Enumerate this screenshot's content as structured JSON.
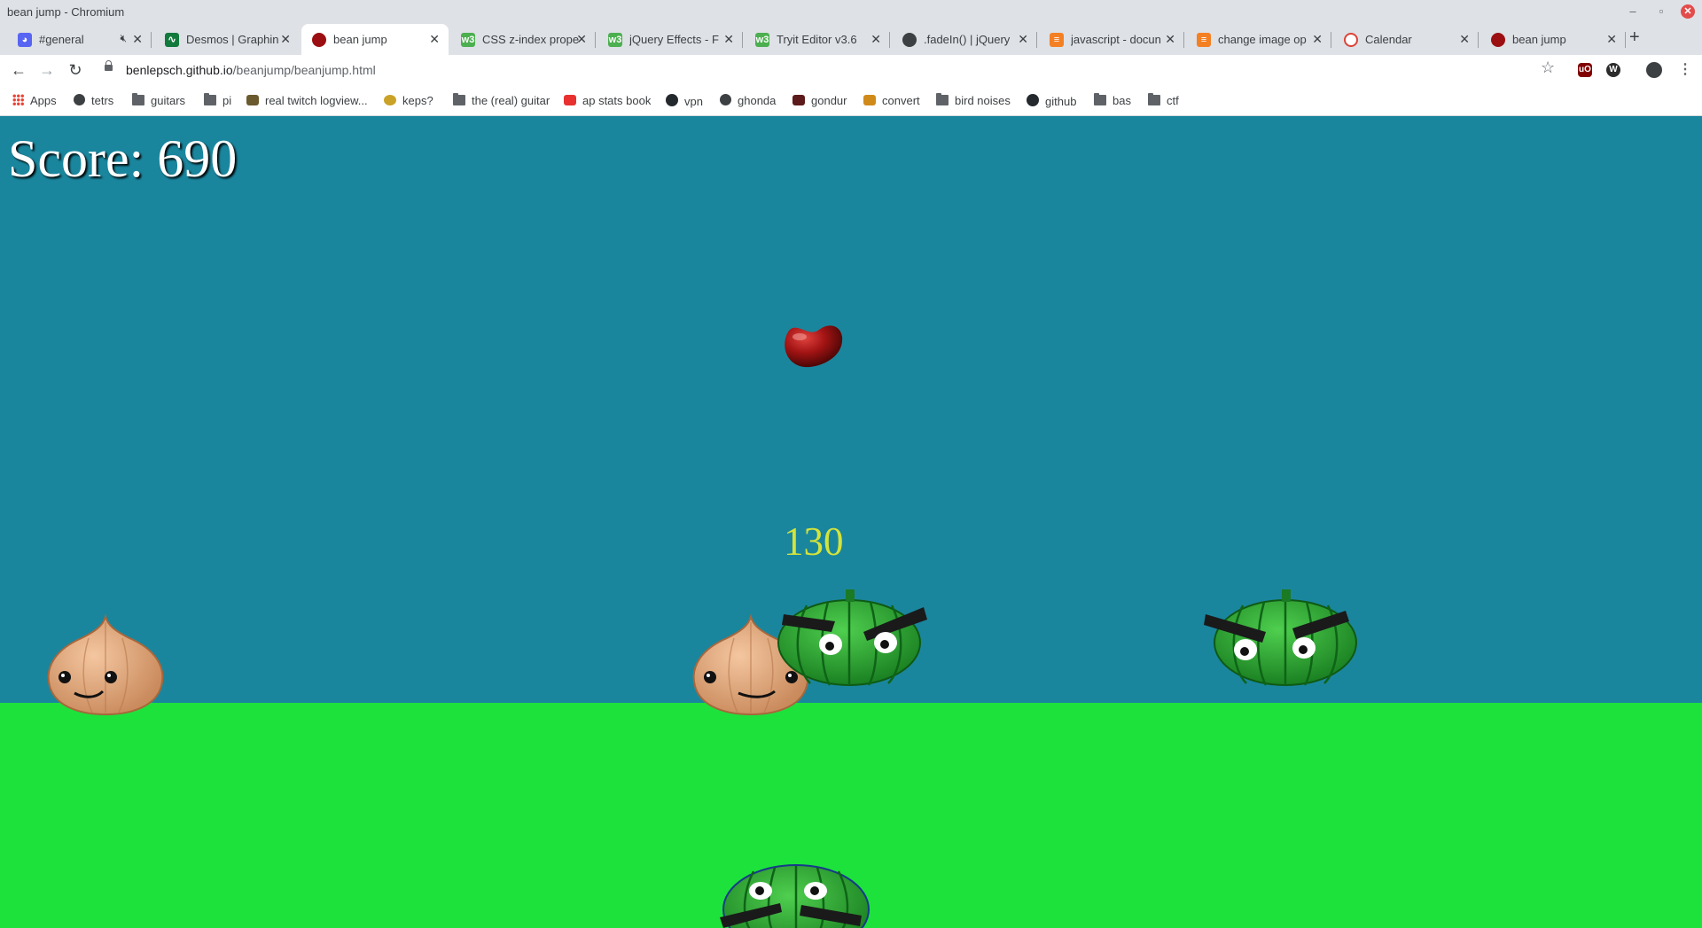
{
  "window": {
    "title": "bean jump - Chromium"
  },
  "tabs": [
    {
      "label": "#general",
      "icon": "discord-icon",
      "color": "#5865f2"
    },
    {
      "label": "Desmos | Graphin",
      "icon": "desmos-icon",
      "color": "#127a3d"
    },
    {
      "label": "bean jump",
      "icon": "bean-icon",
      "color": "#9b0f12",
      "active": true
    },
    {
      "label": "CSS z-index prope",
      "icon": "w3schools-icon",
      "color": "#4caf50"
    },
    {
      "label": "jQuery Effects - F",
      "icon": "w3schools-icon",
      "color": "#4caf50"
    },
    {
      "label": "Tryit Editor v3.6",
      "icon": "w3schools-icon",
      "color": "#4caf50"
    },
    {
      "label": ".fadeIn() | jQuery",
      "icon": "globe-icon",
      "color": "#3c4043"
    },
    {
      "label": "javascript - docun",
      "icon": "stackoverflow-icon",
      "color": "#f48024"
    },
    {
      "label": "change image op",
      "icon": "stackoverflow-icon",
      "color": "#f48024"
    },
    {
      "label": "Calendar",
      "icon": "calendar-icon",
      "color": "#db4437"
    },
    {
      "label": "bean jump",
      "icon": "bean-icon",
      "color": "#9b0f12"
    }
  ],
  "address_bar": {
    "host": "benlepsch.github.io",
    "path": "/beanjump/beanjump.html"
  },
  "bookmarks": [
    {
      "label": "Apps",
      "icon": "apps"
    },
    {
      "label": "tetrs",
      "icon": "globe"
    },
    {
      "label": "guitars",
      "icon": "folder"
    },
    {
      "label": "pi",
      "icon": "folder"
    },
    {
      "label": "real twitch logview...",
      "icon": "misc"
    },
    {
      "label": "keps?",
      "icon": "misc"
    },
    {
      "label": "the (real) guitar",
      "icon": "folder"
    },
    {
      "label": "ap stats book",
      "icon": "misc"
    },
    {
      "label": "vpn",
      "icon": "gh"
    },
    {
      "label": "ghonda",
      "icon": "globe"
    },
    {
      "label": "gondur",
      "icon": "misc"
    },
    {
      "label": "convert",
      "icon": "misc"
    },
    {
      "label": "bird noises",
      "icon": "folder"
    },
    {
      "label": "github",
      "icon": "gh"
    },
    {
      "label": "bas",
      "icon": "folder"
    },
    {
      "label": "ctf",
      "icon": "folder"
    }
  ],
  "game": {
    "score_text": "Score: 690",
    "points_popup": "130",
    "sky_color": "#1a869e",
    "ground_color": "#1de23b"
  }
}
